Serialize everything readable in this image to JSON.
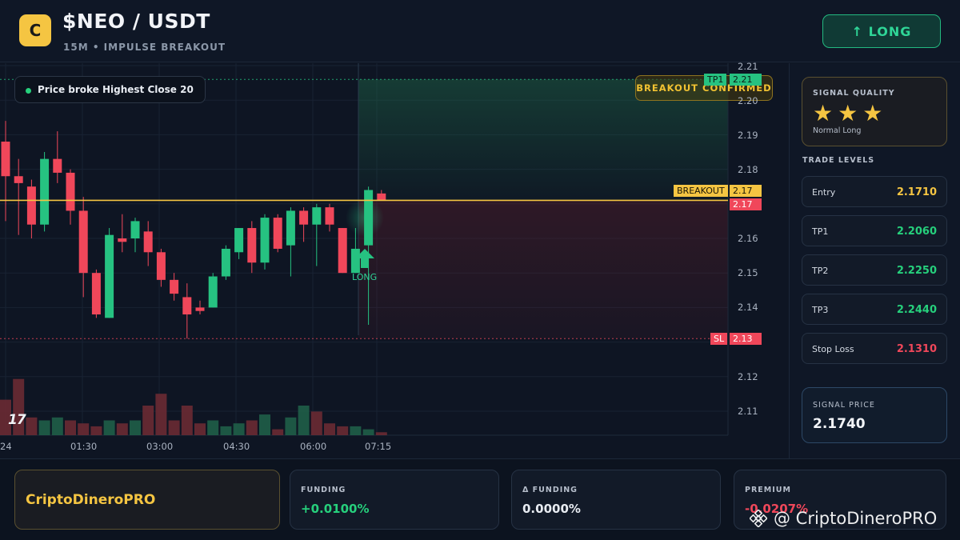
{
  "header": {
    "logo_letter": "C",
    "pair": "$NEO / USDT",
    "subtitle": "15M • IMPULSE BREAKOUT",
    "direction_button": "↑ LONG"
  },
  "chart": {
    "annotation": "Price broke Highest Close 20",
    "breakout_badge": "BREAKOUT CONFIRMED",
    "long_label": "LONG",
    "breakout_tag": "BREAKOUT",
    "breakout_value": "2.17",
    "last_price_value": "2.17",
    "tp1_tag": "TP1",
    "tp1_value": "2.21",
    "sl_tag": "SL",
    "sl_value": "2.13",
    "tv_logo": "17",
    "price_axis": [
      "2.21",
      "2.20",
      "2.19",
      "2.18",
      "2.16",
      "2.15",
      "2.14",
      "2.12",
      "2.11"
    ],
    "time_axis": [
      "24",
      "01:30",
      "03:00",
      "04:30",
      "06:00",
      "07:15"
    ],
    "colors": {
      "up": "#26c281",
      "down": "#f0475a",
      "breakout": "#f5c542",
      "tp": "#26c281"
    },
    "breakout_level": 2.171,
    "tp1_level": 2.206,
    "sl_level": 2.131,
    "candles": [
      {
        "o": 2.188,
        "h": 2.194,
        "l": 2.165,
        "c": 2.178
      },
      {
        "o": 2.178,
        "h": 2.183,
        "l": 2.161,
        "c": 2.176
      },
      {
        "o": 2.175,
        "h": 2.177,
        "l": 2.16,
        "c": 2.164
      },
      {
        "o": 2.164,
        "h": 2.185,
        "l": 2.162,
        "c": 2.183
      },
      {
        "o": 2.183,
        "h": 2.191,
        "l": 2.176,
        "c": 2.179
      },
      {
        "o": 2.179,
        "h": 2.18,
        "l": 2.164,
        "c": 2.168
      },
      {
        "o": 2.168,
        "h": 2.172,
        "l": 2.143,
        "c": 2.15
      },
      {
        "o": 2.15,
        "h": 2.151,
        "l": 2.137,
        "c": 2.138
      },
      {
        "o": 2.137,
        "h": 2.163,
        "l": 2.137,
        "c": 2.161
      },
      {
        "o": 2.16,
        "h": 2.167,
        "l": 2.156,
        "c": 2.159
      },
      {
        "o": 2.16,
        "h": 2.166,
        "l": 2.156,
        "c": 2.165
      },
      {
        "o": 2.162,
        "h": 2.165,
        "l": 2.152,
        "c": 2.156
      },
      {
        "o": 2.156,
        "h": 2.157,
        "l": 2.146,
        "c": 2.148
      },
      {
        "o": 2.148,
        "h": 2.15,
        "l": 2.142,
        "c": 2.144
      },
      {
        "o": 2.143,
        "h": 2.147,
        "l": 2.131,
        "c": 2.138
      },
      {
        "o": 2.14,
        "h": 2.142,
        "l": 2.138,
        "c": 2.139
      },
      {
        "o": 2.14,
        "h": 2.15,
        "l": 2.14,
        "c": 2.149
      },
      {
        "o": 2.149,
        "h": 2.158,
        "l": 2.148,
        "c": 2.157
      },
      {
        "o": 2.156,
        "h": 2.163,
        "l": 2.154,
        "c": 2.163
      },
      {
        "o": 2.163,
        "h": 2.165,
        "l": 2.15,
        "c": 2.153
      },
      {
        "o": 2.153,
        "h": 2.167,
        "l": 2.151,
        "c": 2.166
      },
      {
        "o": 2.166,
        "h": 2.167,
        "l": 2.156,
        "c": 2.157
      },
      {
        "o": 2.158,
        "h": 2.169,
        "l": 2.149,
        "c": 2.168
      },
      {
        "o": 2.168,
        "h": 2.169,
        "l": 2.159,
        "c": 2.164
      },
      {
        "o": 2.164,
        "h": 2.17,
        "l": 2.152,
        "c": 2.169
      },
      {
        "o": 2.169,
        "h": 2.17,
        "l": 2.162,
        "c": 2.164
      },
      {
        "o": 2.163,
        "h": 2.163,
        "l": 2.15,
        "c": 2.15
      },
      {
        "o": 2.15,
        "h": 2.163,
        "l": 2.15,
        "c": 2.157
      },
      {
        "o": 2.158,
        "h": 2.175,
        "l": 2.135,
        "c": 2.174
      },
      {
        "o": 2.173,
        "h": 2.174,
        "l": 2.171,
        "c": 2.171
      }
    ],
    "volumes": [
      {
        "v": 12,
        "d": "down"
      },
      {
        "v": 19,
        "d": "down"
      },
      {
        "v": 6,
        "d": "down"
      },
      {
        "v": 5,
        "d": "up"
      },
      {
        "v": 6,
        "d": "up"
      },
      {
        "v": 5,
        "d": "down"
      },
      {
        "v": 4,
        "d": "down"
      },
      {
        "v": 3,
        "d": "down"
      },
      {
        "v": 5,
        "d": "up"
      },
      {
        "v": 4,
        "d": "down"
      },
      {
        "v": 5,
        "d": "up"
      },
      {
        "v": 10,
        "d": "down"
      },
      {
        "v": 14,
        "d": "down"
      },
      {
        "v": 5,
        "d": "down"
      },
      {
        "v": 10,
        "d": "down"
      },
      {
        "v": 4,
        "d": "down"
      },
      {
        "v": 5,
        "d": "up"
      },
      {
        "v": 3,
        "d": "up"
      },
      {
        "v": 4,
        "d": "up"
      },
      {
        "v": 5,
        "d": "down"
      },
      {
        "v": 7,
        "d": "up"
      },
      {
        "v": 2,
        "d": "down"
      },
      {
        "v": 6,
        "d": "up"
      },
      {
        "v": 10,
        "d": "up"
      },
      {
        "v": 8,
        "d": "down"
      },
      {
        "v": 4,
        "d": "down"
      },
      {
        "v": 3,
        "d": "down"
      },
      {
        "v": 3,
        "d": "up"
      },
      {
        "v": 2,
        "d": "up"
      },
      {
        "v": 1,
        "d": "down"
      }
    ]
  },
  "panel": {
    "signal_quality_title": "SIGNAL QUALITY",
    "stars": "★★★",
    "signal_quality_sub": "Normal Long",
    "trade_levels_title": "TRADE LEVELS",
    "levels": [
      {
        "name": "Entry",
        "value": "2.1710",
        "color": "#f5c542"
      },
      {
        "name": "TP1",
        "value": "2.2060",
        "color": "#26d07c"
      },
      {
        "name": "TP2",
        "value": "2.2250",
        "color": "#26d07c"
      },
      {
        "name": "TP3",
        "value": "2.2440",
        "color": "#26d07c"
      },
      {
        "name": "Stop Loss",
        "value": "2.1310",
        "color": "#f0475a"
      }
    ],
    "signal_price_title": "SIGNAL PRICE",
    "signal_price": "2.1740"
  },
  "footer": {
    "brand": "CriptoDineroPRO",
    "funding_title": "FUNDING",
    "funding_value": "+0.0100%",
    "delta_title": "Δ FUNDING",
    "delta_value": "0.0000%",
    "premium_title": "PREMIUM",
    "premium_value": "-0.0207%",
    "watermark": "@ CriptoDineroPRO"
  }
}
